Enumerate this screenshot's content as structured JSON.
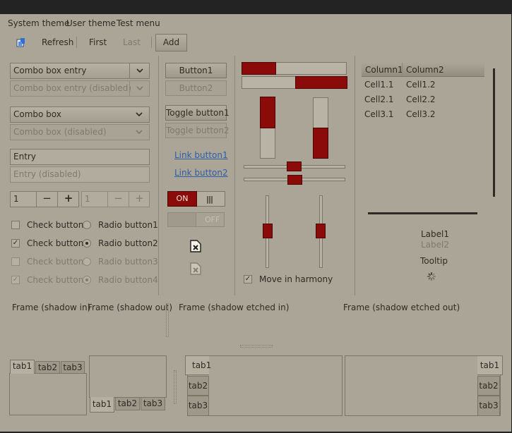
{
  "menu": [
    "System theme",
    "User theme",
    "Test menu"
  ],
  "toolbar": {
    "refresh_label": "Refresh",
    "first_label": "First",
    "last_label": "Last",
    "add_label": "Add"
  },
  "combos": {
    "combo_entry": "Combo box entry",
    "combo_entry_disabled": "Combo box entry (disabled)",
    "combo_box": "Combo box",
    "combo_box_disabled": "Combo box (disabled)"
  },
  "entries": {
    "entry": "Entry",
    "entry_disabled": "Entry (disabled)"
  },
  "spin": {
    "value": "1",
    "value_disabled": "1",
    "minus": "−",
    "plus": "+"
  },
  "checks": [
    {
      "label": "Check button1",
      "checked": false,
      "disabled": false
    },
    {
      "label": "Check button2",
      "checked": true,
      "disabled": false
    },
    {
      "label": "Check button3",
      "checked": false,
      "disabled": true
    },
    {
      "label": "Check button4",
      "checked": true,
      "disabled": true
    }
  ],
  "radios": [
    {
      "label": "Radio button1",
      "selected": false,
      "disabled": false
    },
    {
      "label": "Radio button2",
      "selected": true,
      "disabled": false
    },
    {
      "label": "Radio button3",
      "selected": false,
      "disabled": true
    },
    {
      "label": "Radio button4",
      "selected": true,
      "disabled": true
    }
  ],
  "buttons": {
    "button1": "Button1",
    "button2": "Button2",
    "toggle1": "Toggle button1",
    "toggle2": "Toggle button2",
    "link1": "Link button1",
    "link2": "Link button2"
  },
  "switches": {
    "on_label": "ON",
    "off_label": "OFF"
  },
  "progress": {
    "bar1_fraction": 0.33,
    "bar2_fraction": 0.5
  },
  "harmony_label": "Move in harmony",
  "tree": {
    "columns": [
      "Column1",
      "Column2"
    ],
    "rows": [
      [
        "Cell1.1",
        "Cell1.2"
      ],
      [
        "Cell2.1",
        "Cell2.2"
      ],
      [
        "Cell3.1",
        "Cell3.2"
      ]
    ]
  },
  "labels": {
    "label1": "Label1",
    "label2": "Label2",
    "tooltip": "Tooltip"
  },
  "frames": {
    "shadow_in": "Frame (shadow in)",
    "shadow_out": "Frame (shadow out)",
    "etched_in": "Frame (shadow etched in)",
    "etched_out": "Frame (shadow etched out)"
  },
  "tabs": [
    "tab1",
    "tab2",
    "tab3"
  ],
  "colors": {
    "window_bg": "#aaa596",
    "accent_red": "#8b0b0b",
    "link": "#2d5ea8"
  }
}
